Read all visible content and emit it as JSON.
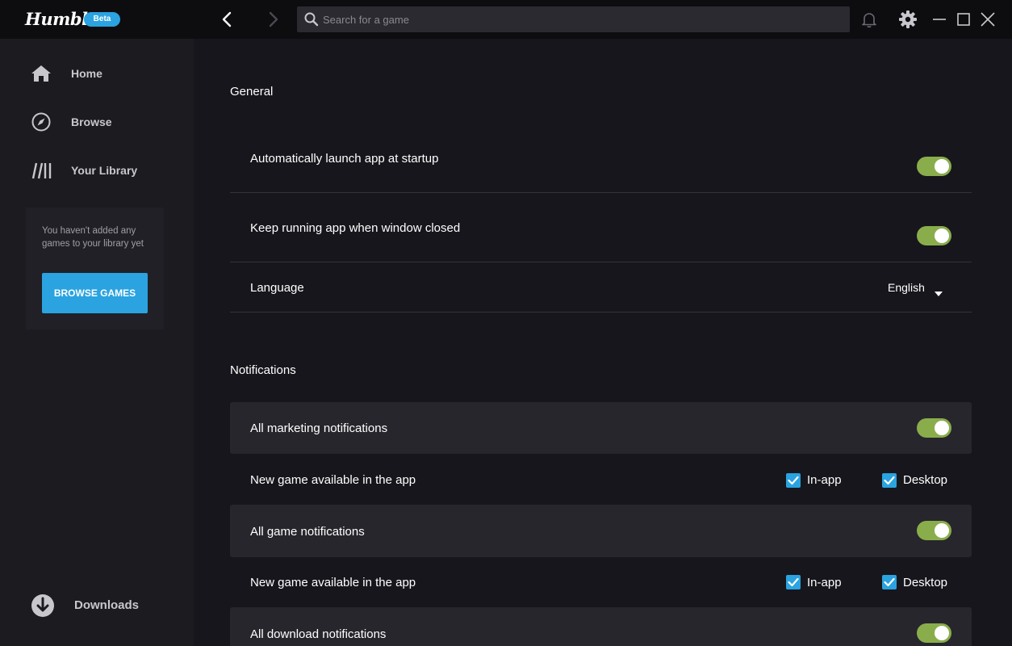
{
  "app": {
    "logo_text": "Humble",
    "beta_badge": "Beta"
  },
  "search": {
    "placeholder": "Search for a game"
  },
  "sidebar": {
    "items": [
      {
        "label": "Home",
        "icon": "home-icon"
      },
      {
        "label": "Browse",
        "icon": "compass-icon"
      },
      {
        "label": "Your Library",
        "icon": "library-icon"
      }
    ],
    "empty_message": "You haven't added any games to your library yet",
    "browse_button": "BROWSE GAMES",
    "downloads_label": "Downloads"
  },
  "settings": {
    "general": {
      "title": "General",
      "auto_launch": {
        "label": "Automatically launch app at startup",
        "enabled": true
      },
      "keep_running": {
        "label": "Keep running app when window closed",
        "enabled": true
      },
      "language": {
        "label": "Language",
        "value": "English"
      }
    },
    "notifications": {
      "title": "Notifications",
      "marketing": {
        "label": "All marketing notifications",
        "enabled": true,
        "sub": {
          "label": "New game available in the app",
          "in_app_label": "In-app",
          "in_app": true,
          "desktop_label": "Desktop",
          "desktop": true
        }
      },
      "game": {
        "label": "All game notifications",
        "enabled": true,
        "sub": {
          "label": "New game available in the app",
          "in_app_label": "In-app",
          "in_app": true,
          "desktop_label": "Desktop",
          "desktop": true
        }
      },
      "download": {
        "label": "All download notifications",
        "enabled": true
      }
    }
  },
  "colors": {
    "accent_blue": "#2aa3e0",
    "toggle_green": "#8aad4c",
    "background": "#17161c",
    "sidebar": "#1b1b20"
  }
}
